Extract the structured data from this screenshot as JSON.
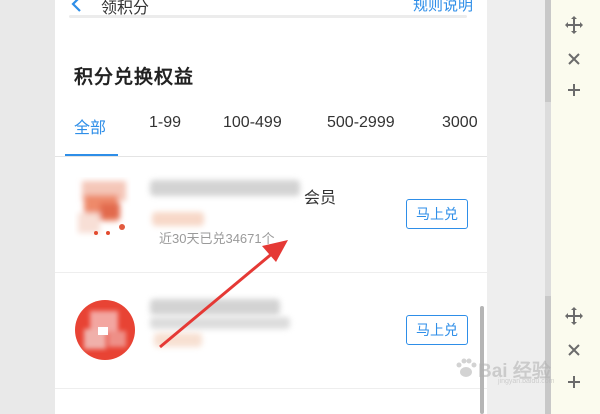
{
  "header": {
    "title": "领积分",
    "rules_link": "规则说明"
  },
  "section": {
    "title": "积分兑换权益"
  },
  "tabs": [
    {
      "label": "全部",
      "active": true
    },
    {
      "label": "1-99",
      "active": false
    },
    {
      "label": "100-499",
      "active": false
    },
    {
      "label": "500-2999",
      "active": false
    },
    {
      "label": "3000",
      "active": false
    }
  ],
  "items": [
    {
      "name_visible": "会员",
      "sales": "近30天已兑34671个",
      "button": "马上兑"
    },
    {
      "name_visible": "",
      "sales": "",
      "button": "马上兑"
    }
  ],
  "watermark": {
    "brand": "Bai 经验",
    "sub": "jingyan.baidu.com"
  },
  "colors": {
    "accent": "#2e8ee8",
    "arrow": "#e53935"
  }
}
